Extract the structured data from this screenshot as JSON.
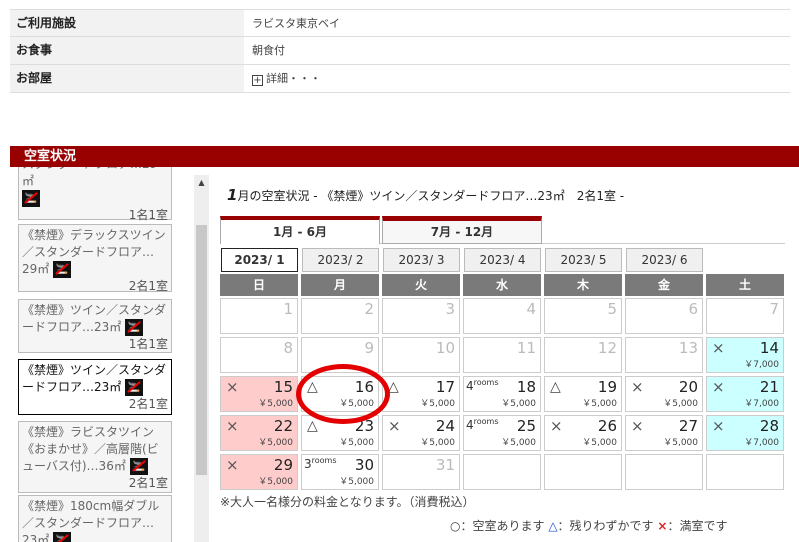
{
  "info": {
    "rows": [
      {
        "label": "ご利用施設",
        "value": "ラビスタ東京ベイ"
      },
      {
        "label": "お食事",
        "value": "朝食付"
      },
      {
        "label": "お部屋",
        "value": "詳細・・・"
      }
    ],
    "expand_glyph": "+"
  },
  "section_title": "空室状況",
  "room_list": {
    "items": [
      {
        "name": "スタンダードフロア…29㎡",
        "count": "1名1室"
      },
      {
        "name": "《禁煙》デラックスツイン／スタンダードフロア…29㎡",
        "count": "2名1室"
      },
      {
        "name": "《禁煙》ツイン／スタンダードフロア…23㎡",
        "count": "1名1室"
      },
      {
        "name": "《禁煙》ツイン／スタンダードフロア…23㎡",
        "count": "2名1室"
      },
      {
        "name": "《禁煙》ラビスタツイン《おまかせ》／高層階(ビューバス付)…36㎡",
        "count": "2名1室"
      },
      {
        "name": "《禁煙》180cm幅ダブル／スタンダードフロア…23㎡",
        "count": ""
      }
    ],
    "nosmoke_icon": "no-smoking-icon",
    "scroll_up_glyph": "▲"
  },
  "calendar": {
    "month": "1",
    "title_suffix": "月の空室状況",
    "room_desc": "- 《禁煙》ツイン／スタンダードフロア…23㎡　2名1室 -",
    "tabs": [
      "1月 - 6月",
      "7月 - 12月"
    ],
    "year_months": [
      "2023/ 1",
      "2023/ 2",
      "2023/ 3",
      "2023/ 4",
      "2023/ 5",
      "2023/ 6"
    ],
    "weekdays": [
      "日",
      "月",
      "火",
      "水",
      "木",
      "金",
      "土"
    ],
    "rooms_label": "rooms",
    "days": [
      {
        "d": "1",
        "past": true
      },
      {
        "d": "2",
        "past": true
      },
      {
        "d": "3",
        "past": true
      },
      {
        "d": "4",
        "past": true
      },
      {
        "d": "5",
        "past": true
      },
      {
        "d": "6",
        "past": true
      },
      {
        "d": "7",
        "past": true
      },
      {
        "d": "8",
        "past": true
      },
      {
        "d": "9",
        "past": true
      },
      {
        "d": "10",
        "past": true
      },
      {
        "d": "11",
        "past": true
      },
      {
        "d": "12",
        "past": true
      },
      {
        "d": "13",
        "past": true
      },
      {
        "d": "14",
        "mark": "×",
        "price": "￥7,000",
        "bg": "cyan"
      },
      {
        "d": "15",
        "mark": "×",
        "price": "￥5,000",
        "bg": "pink"
      },
      {
        "d": "16",
        "mark": "△",
        "price": "￥5,000"
      },
      {
        "d": "17",
        "mark": "△",
        "price": "￥5,000"
      },
      {
        "d": "18",
        "rooms": "4",
        "price": "￥5,000"
      },
      {
        "d": "19",
        "mark": "△",
        "price": "￥5,000"
      },
      {
        "d": "20",
        "mark": "×",
        "price": "￥5,000"
      },
      {
        "d": "21",
        "mark": "×",
        "price": "￥7,000",
        "bg": "cyan"
      },
      {
        "d": "22",
        "mark": "×",
        "price": "￥5,000",
        "bg": "pink"
      },
      {
        "d": "23",
        "mark": "△",
        "price": "￥5,000"
      },
      {
        "d": "24",
        "mark": "×",
        "price": "￥5,000"
      },
      {
        "d": "25",
        "rooms": "4",
        "price": "￥5,000"
      },
      {
        "d": "26",
        "mark": "×",
        "price": "￥5,000"
      },
      {
        "d": "27",
        "mark": "×",
        "price": "￥5,000"
      },
      {
        "d": "28",
        "mark": "×",
        "price": "￥7,000",
        "bg": "cyan"
      },
      {
        "d": "29",
        "mark": "×",
        "price": "￥5,000",
        "bg": "pink"
      },
      {
        "d": "30",
        "rooms": "3",
        "price": "￥5,000"
      },
      {
        "d": "31",
        "past": true
      }
    ],
    "note": "※大人一名様分の料金となります。（消費税込）",
    "legend": {
      "circle": "○：空室あります",
      "tri_mark": "△",
      "tri_text": "：残りわずかです",
      "cross_mark": "×",
      "cross_text": "：満室です"
    }
  },
  "colors": {
    "accent": "#990000",
    "highlight": "#e30000",
    "sunday": "#ffcccc",
    "saturday": "#ccffff"
  }
}
